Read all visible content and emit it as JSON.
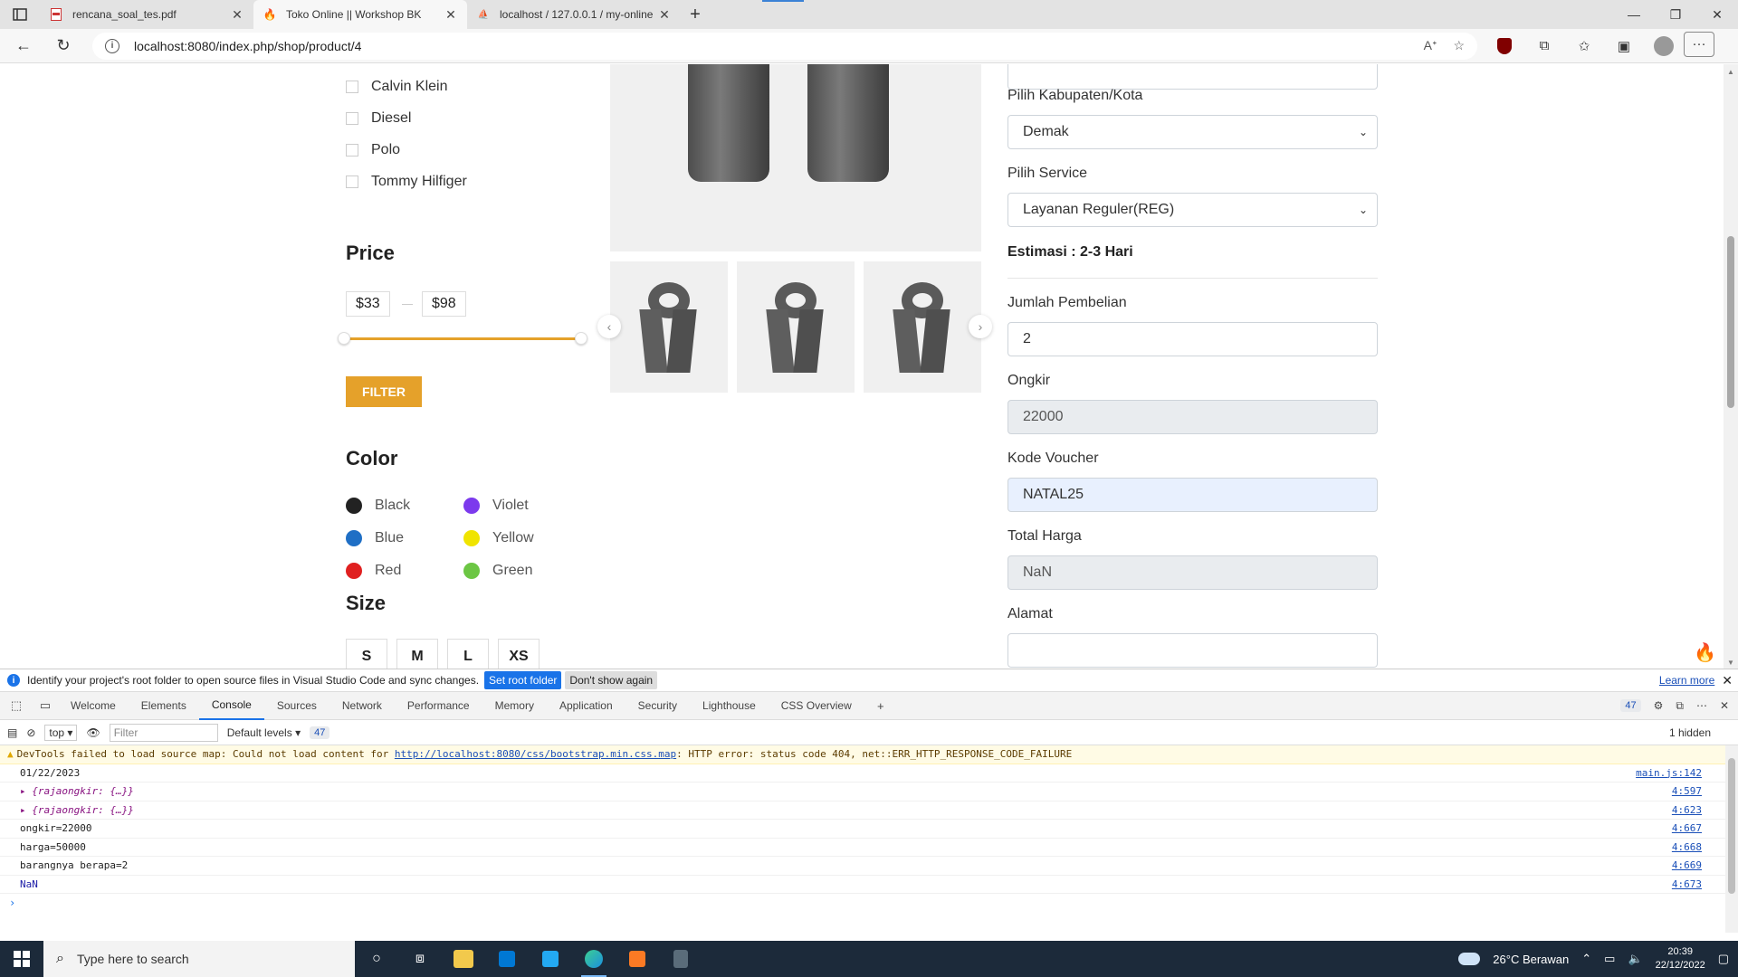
{
  "browser": {
    "tabs": [
      {
        "label": "rencana_soal_tes.pdf",
        "icon": "pdf-icon"
      },
      {
        "label": "Toko Online || Workshop BK",
        "icon": "flame-icon"
      },
      {
        "label": "localhost / 127.0.0.1 / my-online",
        "icon": "phpmyadmin-icon"
      }
    ],
    "url": "localhost:8080/index.php/shop/product/4"
  },
  "filters": {
    "brands": [
      "Calvin Klein",
      "Diesel",
      "Polo",
      "Tommy Hilfiger"
    ],
    "price_title": "Price",
    "price_min": "$33",
    "price_max": "$98",
    "filter_button": "FILTER",
    "color_title": "Color",
    "colors": [
      {
        "name": "Black",
        "hex": "#222222"
      },
      {
        "name": "Violet",
        "hex": "#7c3aed"
      },
      {
        "name": "Blue",
        "hex": "#1f6fc5"
      },
      {
        "name": "Yellow",
        "hex": "#f0e400"
      },
      {
        "name": "Red",
        "hex": "#e02020"
      },
      {
        "name": "Green",
        "hex": "#6cc644"
      }
    ],
    "size_title": "Size",
    "sizes": [
      "S",
      "M",
      "L",
      "XS"
    ]
  },
  "form": {
    "kabupaten_label": "Pilih Kabupaten/Kota",
    "kabupaten_value": "Demak",
    "service_label": "Pilih Service",
    "service_value": "Layanan Reguler(REG)",
    "estimasi": "Estimasi : 2-3 Hari",
    "jumlah_label": "Jumlah Pembelian",
    "jumlah_value": "2",
    "ongkir_label": "Ongkir",
    "ongkir_value": "22000",
    "voucher_label": "Kode Voucher",
    "voucher_value": "NATAL25",
    "total_label": "Total Harga",
    "total_value": "NaN",
    "alamat_label": "Alamat"
  },
  "devtools": {
    "infobar_text": "Identify your project's root folder to open source files in Visual Studio Code and sync changes.",
    "set_root": "Set root folder",
    "dont_show": "Don't show again",
    "learn_more": "Learn more",
    "tabs": [
      "Welcome",
      "Elements",
      "Console",
      "Sources",
      "Network",
      "Performance",
      "Memory",
      "Application",
      "Security",
      "Lighthouse",
      "CSS Overview"
    ],
    "message_count": "47",
    "context": "top",
    "filter_placeholder": "Filter",
    "levels": "Default levels",
    "hidden": "1 hidden",
    "warning": {
      "prefix": "DevTools failed to load source map: Could not load content for ",
      "link": "http://localhost:8080/css/bootstrap.min.css.map",
      "suffix": ": HTTP error: status code 404, net::ERR_HTTP_RESPONSE_CODE_FAILURE"
    },
    "logs": [
      {
        "text": "01/22/2023",
        "src": "main.js:142"
      },
      {
        "text": "{rajaongkir: {…}}",
        "src": "4:597"
      },
      {
        "text": "{rajaongkir: {…}}",
        "src": "4:623"
      },
      {
        "text": "ongkir=22000",
        "src": "4:667"
      },
      {
        "text": "harga=50000",
        "src": "4:668"
      },
      {
        "text": "barangnya berapa=2",
        "src": "4:669"
      },
      {
        "text": "NaN",
        "src": "4:673"
      }
    ]
  },
  "taskbar": {
    "search_placeholder": "Type here to search",
    "weather": "26°C  Berawan",
    "time": "20:39",
    "date": "22/12/2022"
  }
}
